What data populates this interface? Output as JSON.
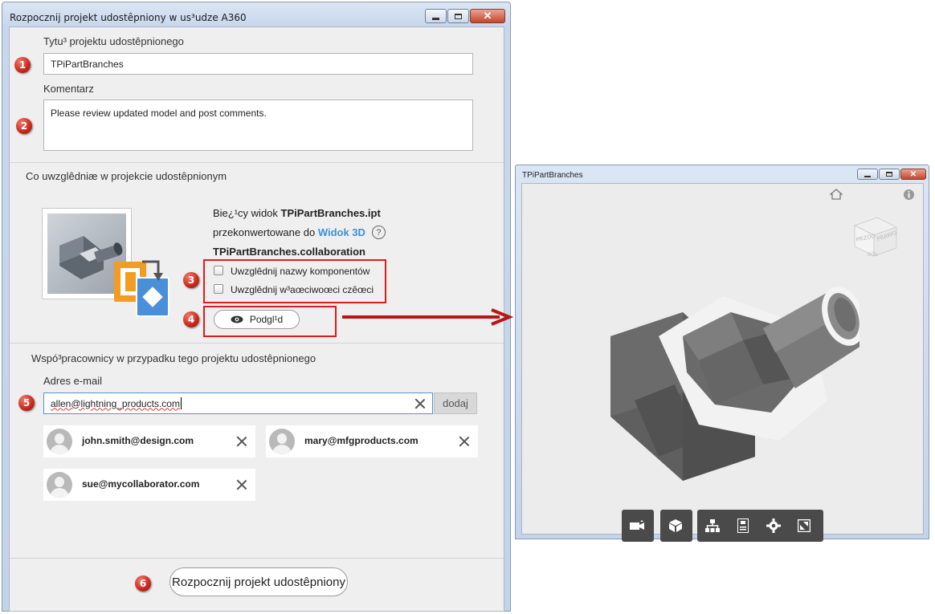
{
  "dialog": {
    "title": "Rozpocznij projekt udostêpniony w us³udze A360",
    "project_title_label": "Tytu³ projektu udostêpnionego",
    "project_title_value": "TPiPartBranches",
    "comment_label": "Komentarz",
    "comment_value": "Please review updated model and post comments.",
    "include_heading": "Co uwzglêdniæ w projekcie udostêpnionym",
    "current_view_prefix": "Bie¿¹cy widok ",
    "current_view_file": "TPiPartBranches.ipt",
    "converted_prefix": "przekonwertowane do ",
    "widok_3d_link": "Widok 3D",
    "help_glyph": "?",
    "collab_file": "TPiPartBranches.collaboration",
    "checkbox_components": "Uwzglêdnij nazwy komponentów",
    "checkbox_properties": "Uwzglêdnij w³aœciwoœci czêœci",
    "preview_button": "Podgl¹d",
    "collaborators_heading": "Wspó³pracownicy w przypadku tego projektu udostêpnionego",
    "email_label": "Adres e-mail",
    "email_value": "allen@lightning_products.com",
    "add_button": "dodaj",
    "collaborators": [
      "john.smith@design.com",
      "mary@mfgproducts.com",
      "sue@mycollaborator.com"
    ],
    "start_button": "Rozpocznij projekt udostêpniony",
    "badges": [
      "1",
      "2",
      "3",
      "4",
      "5",
      "6"
    ]
  },
  "preview_window": {
    "title": "TPiPartBranches",
    "viewcube_labels": [
      "PRZÓD",
      "PRAWO",
      "DÓŁ"
    ],
    "toolbar_icons": [
      "camera-icon",
      "model-icon",
      "structure-icon",
      "properties-icon",
      "settings-icon",
      "fullscreen-icon"
    ]
  },
  "colors": {
    "badge": "#c8261c",
    "highlight_box": "#e01b1b",
    "link": "#3d8fd6",
    "arrow": "#b51717"
  }
}
